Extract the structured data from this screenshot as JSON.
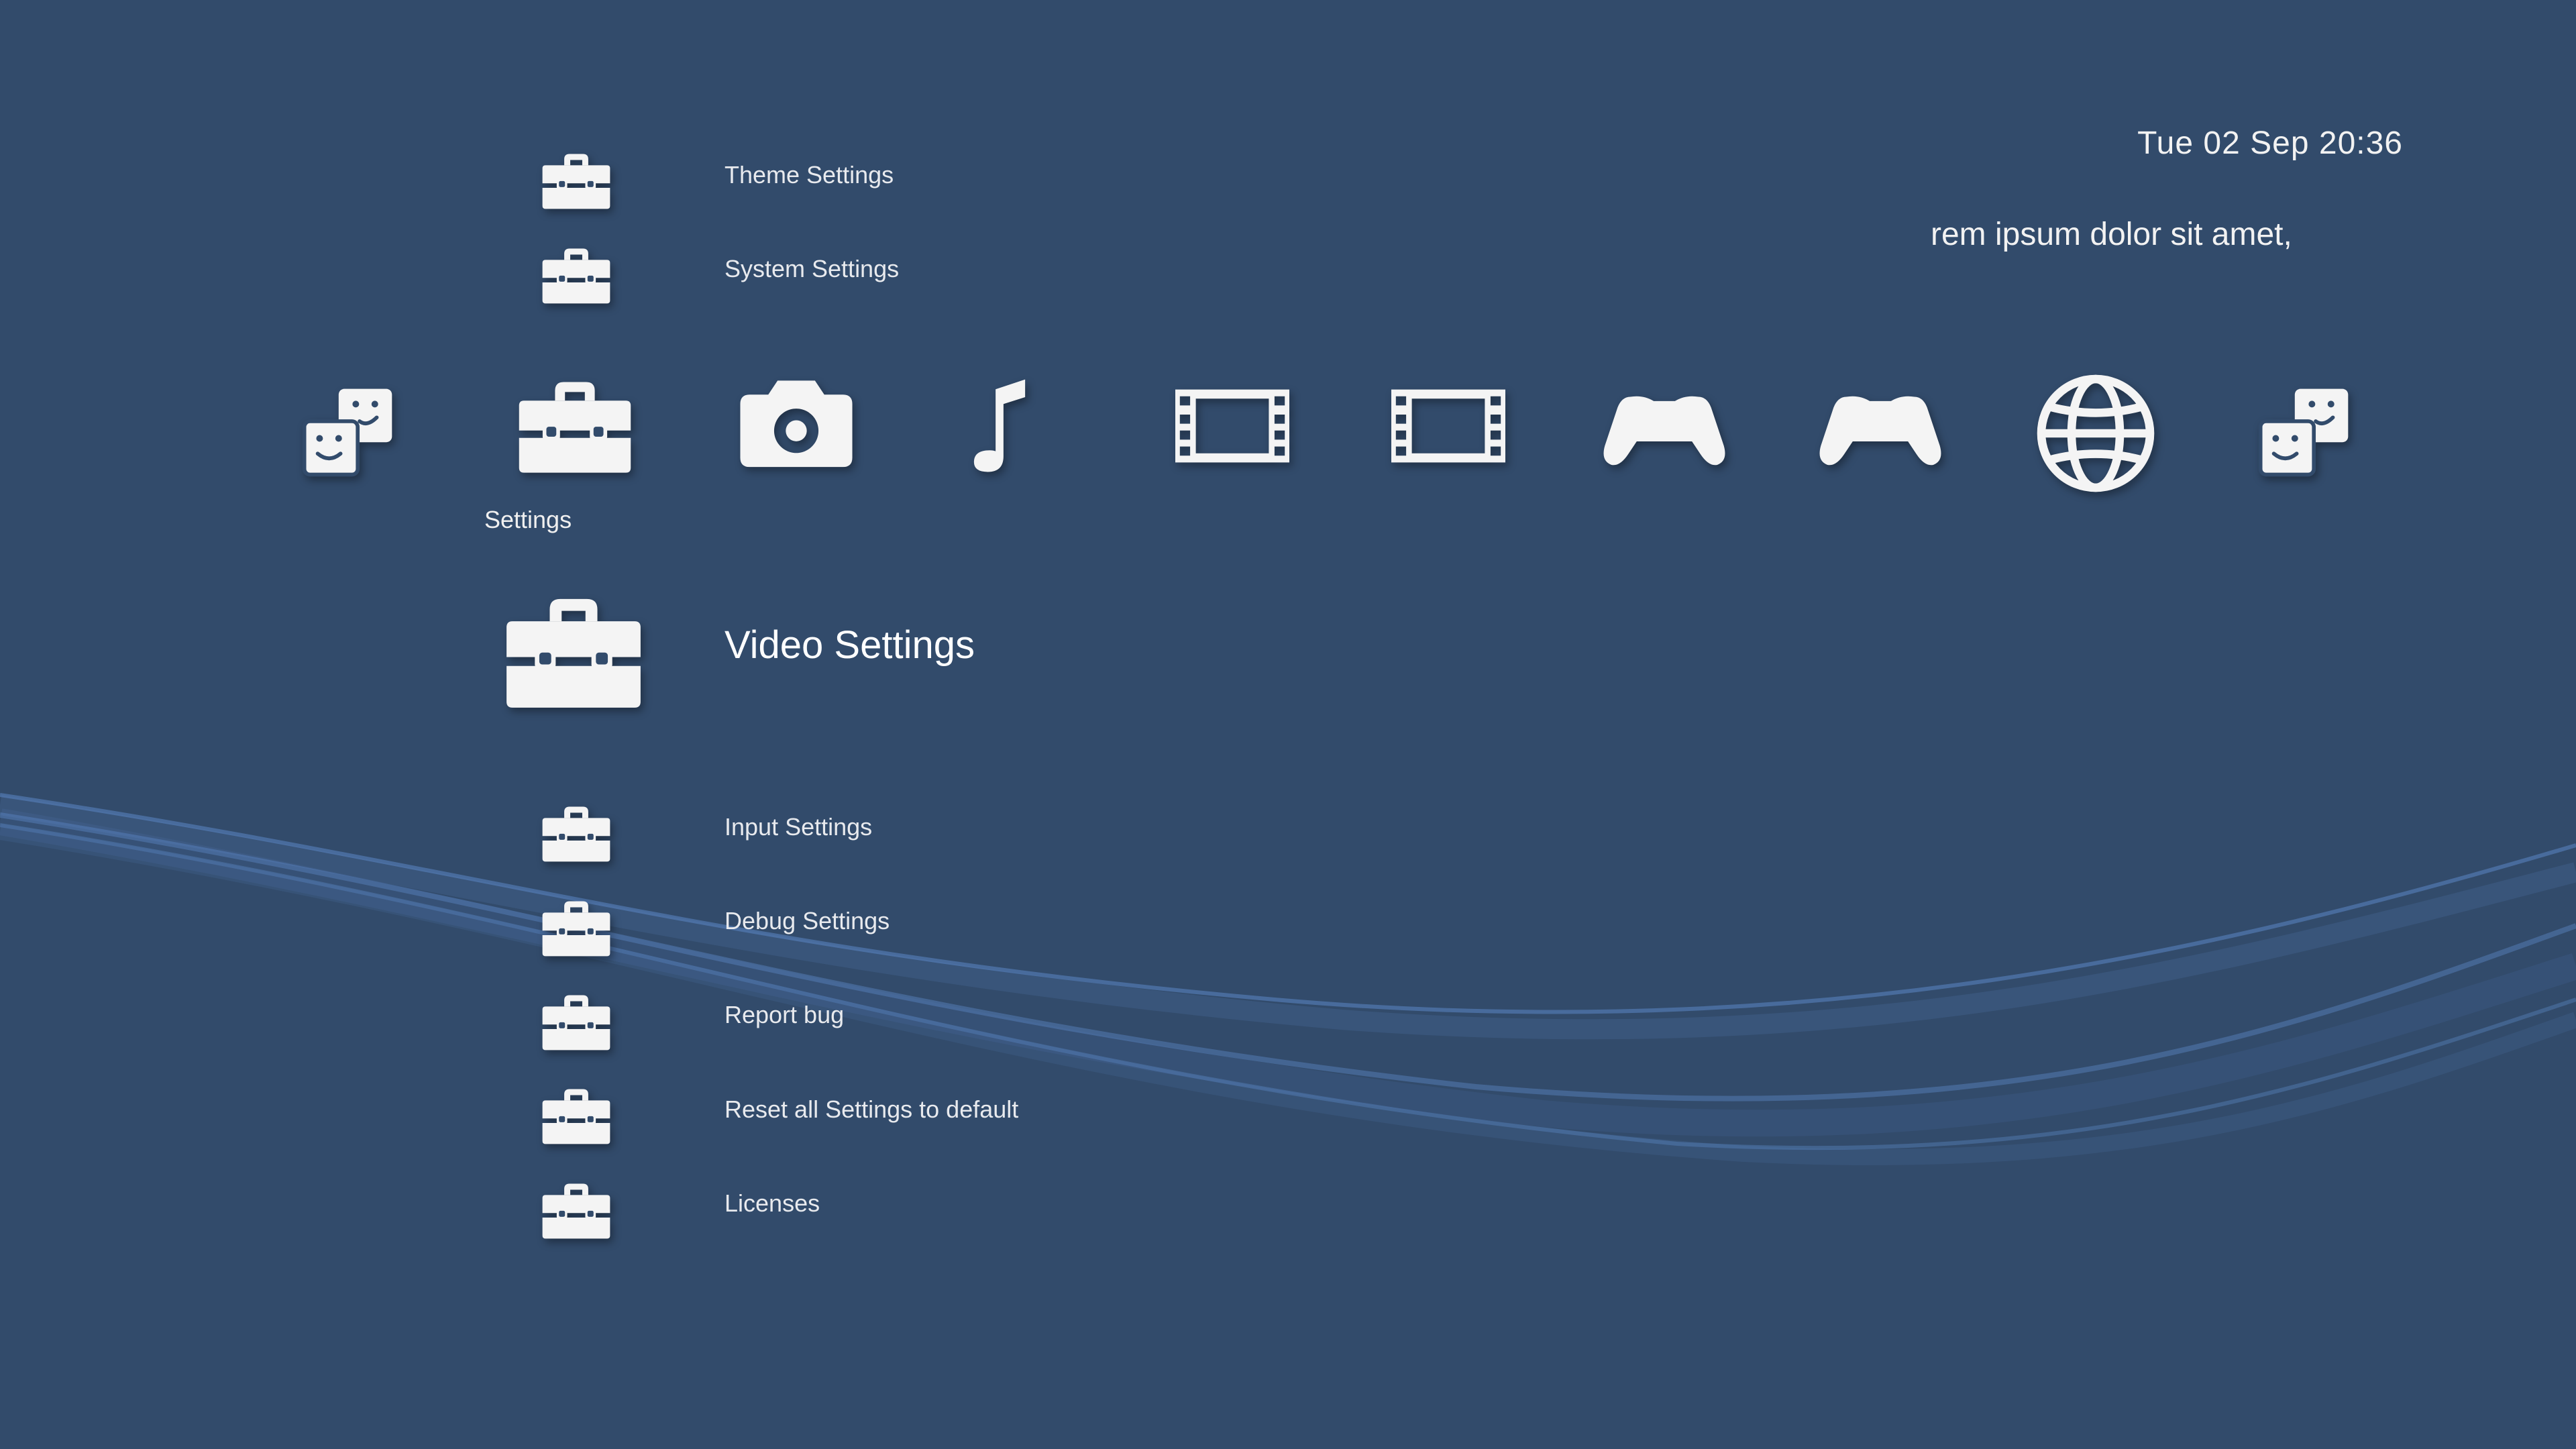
{
  "status": {
    "clock": "Tue 02 Sep 20:36",
    "ticker": "rem ipsum dolor sit amet,"
  },
  "categories": [
    {
      "id": "users",
      "icon": "users-faces-icon",
      "label": ""
    },
    {
      "id": "settings",
      "icon": "toolbox-icon",
      "label": "Settings",
      "selected": true
    },
    {
      "id": "photo",
      "icon": "camera-icon",
      "label": ""
    },
    {
      "id": "music",
      "icon": "music-note-icon",
      "label": ""
    },
    {
      "id": "video",
      "icon": "film-strip-icon",
      "label": ""
    },
    {
      "id": "tv",
      "icon": "film-strip-icon",
      "label": ""
    },
    {
      "id": "game",
      "icon": "gamepad-icon",
      "label": ""
    },
    {
      "id": "netplay",
      "icon": "gamepad-icon",
      "label": ""
    },
    {
      "id": "network",
      "icon": "globe-icon",
      "label": ""
    },
    {
      "id": "friends",
      "icon": "users-faces-icon",
      "label": ""
    }
  ],
  "settings_menu": {
    "category_label": "Settings",
    "items_above": [
      {
        "label": "Theme Settings",
        "icon": "toolbox-icon"
      },
      {
        "label": "System Settings",
        "icon": "toolbox-icon"
      }
    ],
    "selected": {
      "label": "Video Settings",
      "icon": "toolbox-icon"
    },
    "items_below": [
      {
        "label": "Input Settings",
        "icon": "toolbox-icon"
      },
      {
        "label": "Debug Settings",
        "icon": "toolbox-icon"
      },
      {
        "label": "Report bug",
        "icon": "toolbox-icon"
      },
      {
        "label": "Reset all Settings to default",
        "icon": "toolbox-icon"
      },
      {
        "label": "Licenses",
        "icon": "toolbox-icon"
      }
    ]
  },
  "colors": {
    "background": "#324b6b",
    "wave": "#5b86c4",
    "icon": "#f4f4f4"
  }
}
